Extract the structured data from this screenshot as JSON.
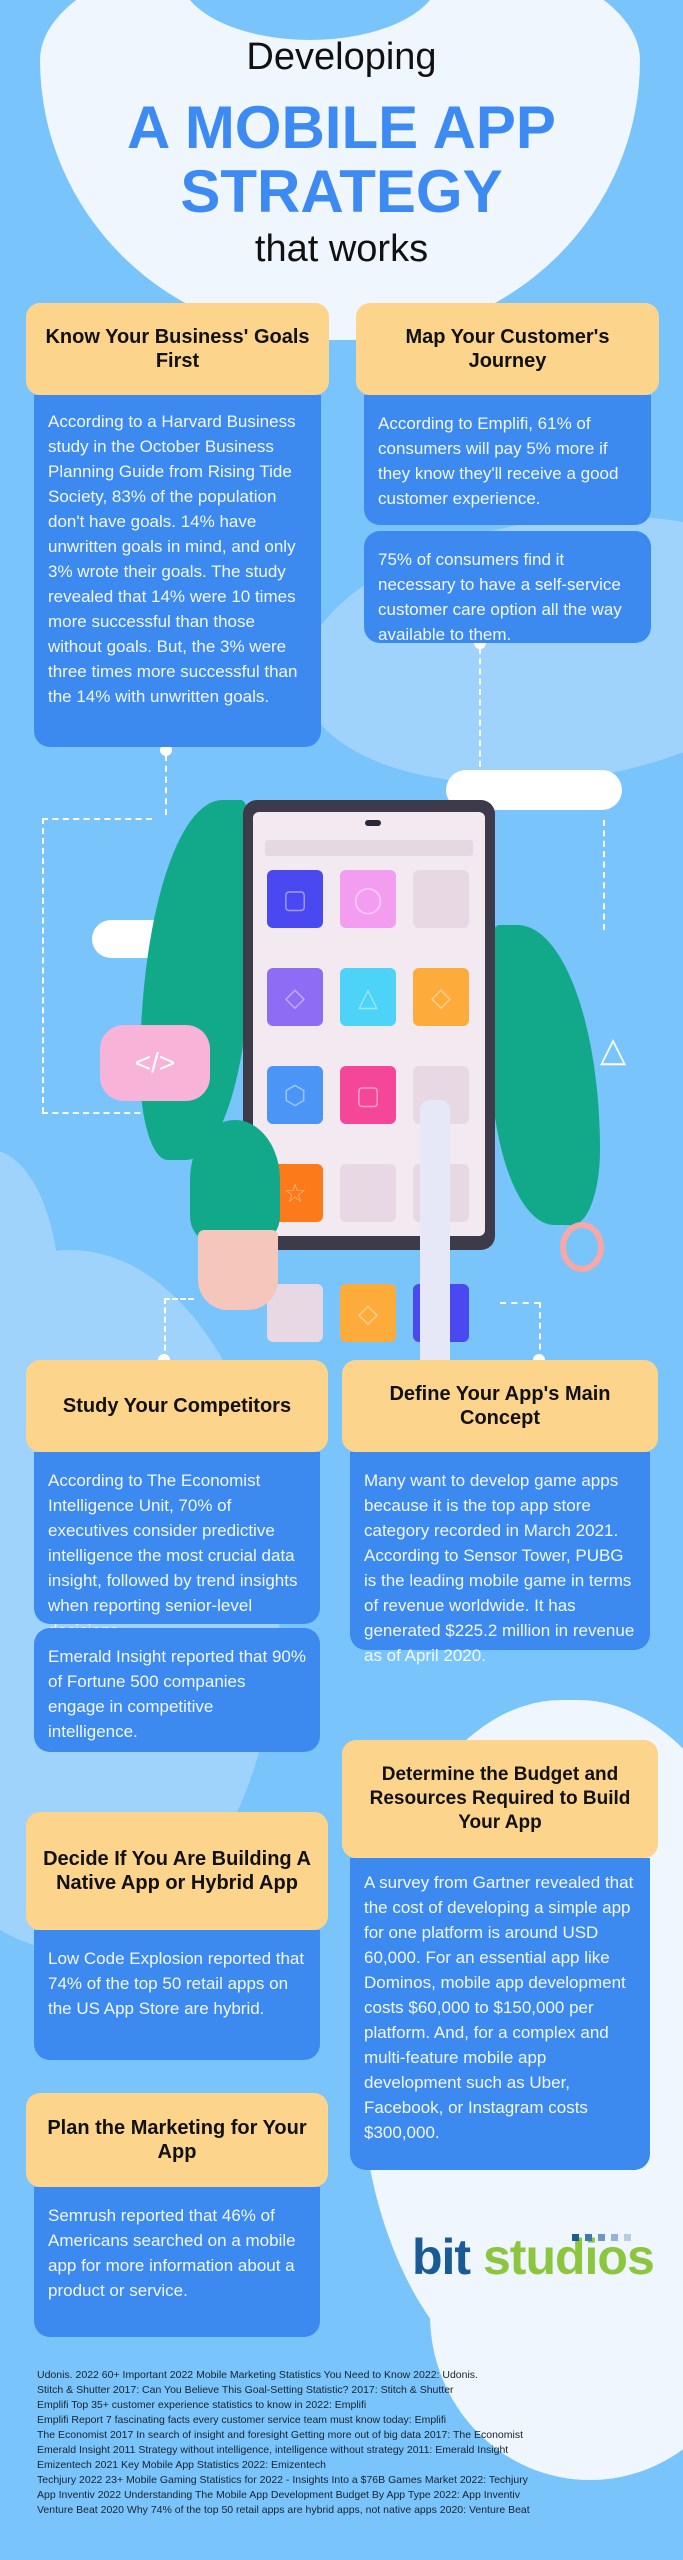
{
  "header": {
    "line1": "Developing",
    "line2": "A MOBILE APP",
    "line3": "STRATEGY",
    "line4": "that works"
  },
  "sections": {
    "goals": {
      "title": "Know Your Business' Goals First",
      "body": [
        "According to a Harvard Business study in the October Business Planning Guide from Rising Tide Society, 83% of the population don't have goals. 14% have unwritten goals in mind, and only 3% wrote their goals. The study revealed that 14% were 10 times more successful than those without goals. But, the 3% were three times more successful than the 14% with unwritten goals."
      ]
    },
    "journey": {
      "title": "Map Your Customer's Journey",
      "body": [
        "According to Emplifi, 61% of consumers will pay 5% more if they know they'll receive a good customer experience.",
        "75% of consumers find it necessary to have a self-service customer care option all the way available to them."
      ]
    },
    "competitors": {
      "title": "Study Your Competitors",
      "body": [
        "According to The Economist Intelligence Unit, 70% of executives consider predictive intelligence the most crucial data insight, followed by trend insights when reporting senior-level decisions.",
        "Emerald Insight reported that 90% of Fortune 500 companies engage in competitive intelligence."
      ]
    },
    "concept": {
      "title": "Define Your App's Main Concept",
      "body": [
        "Many want to develop game apps because it is the top app store category recorded in March 2021. According to Sensor Tower, PUBG is the leading mobile game in terms of revenue worldwide. It has generated $225.2 million in revenue as of April 2020."
      ]
    },
    "budget": {
      "title": "Determine the Budget and Resources Required to Build Your App",
      "body": [
        "A survey from Gartner revealed that the cost of developing a simple app for one platform is around USD 60,000. For an essential app like Dominos, mobile app development costs $60,000 to $150,000 per platform. And, for a complex and multi-feature mobile app development such as Uber, Facebook, or Instagram costs $300,000."
      ]
    },
    "native": {
      "title": "Decide If You Are Building A Native App or Hybrid App",
      "body": [
        "Low Code Explosion reported that 74% of the top 50 retail apps on the US App Store are hybrid."
      ]
    },
    "marketing": {
      "title": "Plan the Marketing for Your App",
      "body": [
        "Semrush reported that 46% of Americans searched on a mobile app for more information about a product or service."
      ]
    }
  },
  "illustration": {
    "code_bubble": "</>",
    "tiles": [
      {
        "color": "#4a48f0",
        "glyph": "▢"
      },
      {
        "color": "#f29df0",
        "glyph": "◯"
      },
      {
        "color": "#e7d8e4",
        "glyph": ""
      },
      {
        "color": "#8f6cf4",
        "glyph": "◇"
      },
      {
        "color": "#4dd3f7",
        "glyph": "△"
      },
      {
        "color": "#fdab3a",
        "glyph": "◇"
      },
      {
        "color": "#4b95f7",
        "glyph": "⬡"
      },
      {
        "color": "#f5479a",
        "glyph": "▢"
      },
      {
        "color": "#e7d8e4",
        "glyph": ""
      },
      {
        "color": "#fd7a1a",
        "glyph": "☆"
      },
      {
        "color": "#e7d8e4",
        "glyph": ""
      },
      {
        "color": "#e7d8e4",
        "glyph": ""
      },
      {
        "color": "#e7d8e4",
        "glyph": ""
      },
      {
        "color": "#fdab3a",
        "glyph": "◇"
      },
      {
        "color": "#4a48f0",
        "glyph": ""
      }
    ]
  },
  "logo": {
    "part1": "bit",
    "part2": "studios",
    "dot_colors": [
      "#1a5a95",
      "#3f79ad",
      "#6b97c2",
      "#93b4d4",
      "#b8cde2"
    ]
  },
  "references": [
    "Udonis. 2022 60+ Important 2022 Mobile Marketing Statistics You Need to Know 2022: Udonis.",
    "Stitch & Shutter 2017: Can You Believe This Goal-Setting Statistic? 2017: Stitch & Shutter",
    "Emplifi Top 35+ customer experience statistics to know in 2022: Emplifi",
    "Emplifi Report 7 fascinating facts every customer service team must know today: Emplifi",
    "The Economist 2017 In search of insight and foresight Getting more out of big data 2017: The Economist",
    "Emerald Insight 2011 Strategy without intelligence, intelligence without strategy 2011: Emerald Insight",
    "Emizentech 2021 Key Mobile App Statistics 2022: Emizentech",
    "Techjury 2022 23+ Mobile Gaming Statistics for 2022 - Insights Into a $76B Games Market 2022: Techjury",
    "App Inventiv 2022 Understanding The Mobile App Development Budget By App Type 2022: App Inventiv",
    "Venture Beat 2020 Why 74% of the top 50 retail apps are hybrid apps, not native apps 2020: Venture Beat"
  ],
  "colors": {
    "background": "#79c4fb",
    "light_blob": "#eff6fd",
    "heading_box": "#fdd48c",
    "body_box": "#3c8af0",
    "title_accent": "#3d8bf2"
  }
}
